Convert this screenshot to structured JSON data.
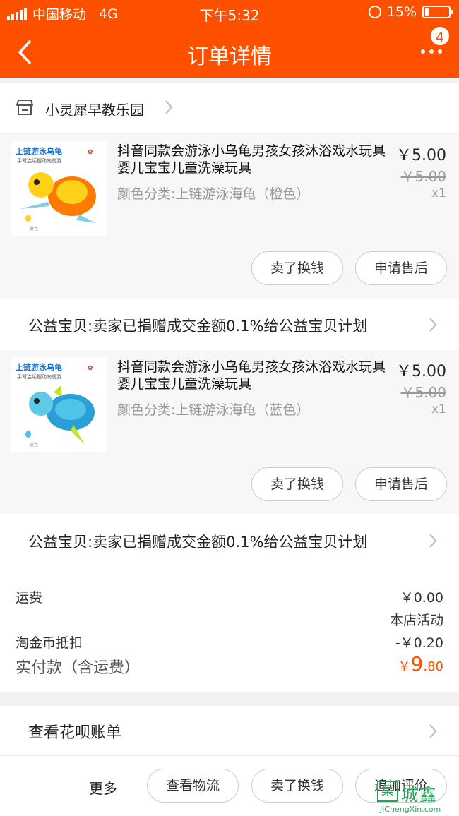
{
  "status_bar": {
    "carrier": "中国移动",
    "network": "4G",
    "time": "下午5:32",
    "battery": "15%"
  },
  "nav": {
    "title": "订单详情",
    "badge": "4"
  },
  "store": {
    "name": "小灵犀早教乐园"
  },
  "items": [
    {
      "title": "抖音同款会游泳小乌龟男孩女孩沐浴戏水玩具婴儿宝宝儿童洗澡玩具",
      "sku": "颜色分类:上链游泳海龟（橙色）",
      "price": "￥5.00",
      "original_price": "￥5.00",
      "qty": "x1",
      "image": {
        "banner": "上链游泳乌龟",
        "sub": "手臂连续摆动向前游",
        "color_tag": "黄色",
        "body_color": "#ff7a00"
      },
      "actions": [
        "卖了换钱",
        "申请售后"
      ]
    },
    {
      "title": "抖音同款会游泳小乌龟男孩女孩沐浴戏水玩具婴儿宝宝儿童洗澡玩具",
      "sku": "颜色分类:上链游泳海龟（蓝色）",
      "price": "￥5.00",
      "original_price": "￥5.00",
      "qty": "x1",
      "image": {
        "banner": "上链游泳乌龟",
        "sub": "手臂连续摆动向前游",
        "color_tag": "蓝色",
        "body_color": "#2a9fd6"
      },
      "actions": [
        "卖了换钱",
        "申请售后"
      ]
    }
  ],
  "charity": {
    "text": "公益宝贝:卖家已捐赠成交金额0.1%给公益宝贝计划"
  },
  "summary": {
    "shipping_label": "运费",
    "shipping_value": "￥0.00",
    "activity": "本店活动",
    "coin_label": "淘金币抵扣",
    "coin_value": "-￥0.20",
    "paid_label": "实付款（含运费）",
    "paid_symbol": "￥",
    "paid_int": "9",
    "paid_dec": ".80"
  },
  "huabei": {
    "text": "查看花呗账单"
  },
  "bottom": {
    "more": "更多",
    "buttons": [
      "查看物流",
      "卖了换钱",
      "追加评价"
    ]
  },
  "watermark": {
    "cn": "城鑫",
    "en": "JiChengXin.com",
    "box": "集"
  },
  "colors": {
    "accent": "#ff5000",
    "page_bg": "#f2f2f2"
  }
}
